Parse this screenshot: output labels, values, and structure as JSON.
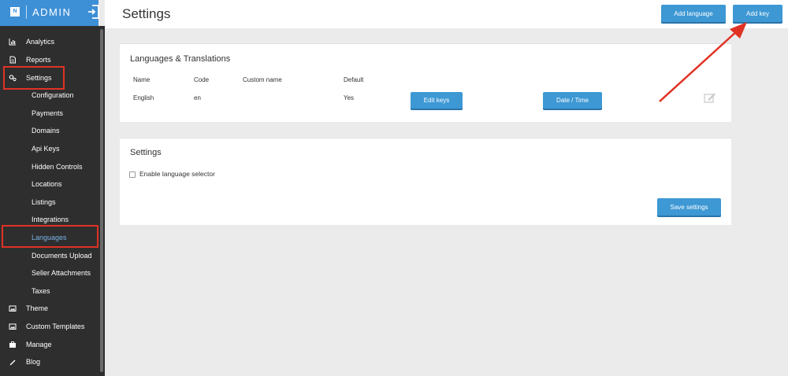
{
  "sidebar": {
    "logo": "N",
    "brand": "ADMIN",
    "nav": [
      {
        "label": "Analytics",
        "icon": "bar-chart-icon"
      },
      {
        "label": "Reports",
        "icon": "document-icon"
      },
      {
        "label": "Settings",
        "icon": "gears-icon"
      },
      {
        "label": "Theme",
        "icon": "image-icon"
      },
      {
        "label": "Custom Templates",
        "icon": "image-icon"
      },
      {
        "label": "Manage",
        "icon": "briefcase-icon"
      },
      {
        "label": "Blog",
        "icon": "pencil-icon"
      }
    ],
    "settings_sub": [
      {
        "label": "Configuration"
      },
      {
        "label": "Payments"
      },
      {
        "label": "Domains"
      },
      {
        "label": "Api Keys"
      },
      {
        "label": "Hidden Controls"
      },
      {
        "label": "Locations"
      },
      {
        "label": "Listings"
      },
      {
        "label": "Integrations"
      },
      {
        "label": "Languages"
      },
      {
        "label": "Documents Upload"
      },
      {
        "label": "Seller Attachments"
      },
      {
        "label": "Taxes"
      }
    ]
  },
  "header": {
    "title": "Settings",
    "add_language_label": "Add language",
    "add_key_label": "Add key"
  },
  "languages_card": {
    "title": "Languages & Translations",
    "columns": [
      "Name",
      "Code",
      "Custom name",
      "Default"
    ],
    "rows": [
      {
        "name": "English",
        "code": "en",
        "custom_name": "",
        "default": "Yes",
        "edit_keys_label": "Edit keys",
        "date_time_label": "Date / Time"
      }
    ]
  },
  "settings_card": {
    "title": "Settings",
    "checkbox_label": "Enable language selector",
    "save_label": "Save settings"
  },
  "colors": {
    "accent": "#3d98d4",
    "sidebar_bg": "#2e2e2e",
    "highlight": "#e03224"
  }
}
